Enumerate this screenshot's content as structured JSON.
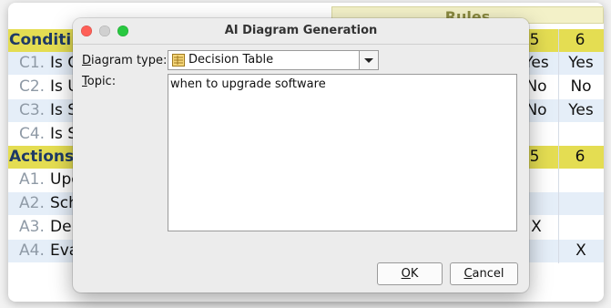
{
  "background_table": {
    "rules_header": "Rules",
    "conditions_label": "Conditi",
    "actions_label": "Actions",
    "rule_numbers": [
      "5",
      "6"
    ],
    "conditions": [
      {
        "id": "C1.",
        "text": "Is C",
        "r5": "Yes",
        "r6": "Yes"
      },
      {
        "id": "C2.",
        "text": "Is U",
        "r5": "No",
        "r6": "No"
      },
      {
        "id": "C3.",
        "text": "Is S",
        "r5": "No",
        "r6": "Yes"
      },
      {
        "id": "C4.",
        "text": "Is S",
        "r5": "",
        "r6": ""
      }
    ],
    "actions": [
      {
        "id": "A1.",
        "text": "Upg",
        "r5": "",
        "r6": ""
      },
      {
        "id": "A2.",
        "text": "Sch",
        "r5": "",
        "r6": ""
      },
      {
        "id": "A3.",
        "text": "Del",
        "r5": "X",
        "r6": ""
      },
      {
        "id": "A4.",
        "text": "Eva",
        "r5": "",
        "r6": "X"
      }
    ]
  },
  "dialog": {
    "title": "AI Diagram Generation",
    "diagram_type_label_pre": "",
    "diagram_type_label_mnemonic": "D",
    "diagram_type_label_post": "iagram type:",
    "diagram_type_value": "Decision Table",
    "topic_label_mnemonic": "T",
    "topic_label_post": "opic:",
    "topic_value": "when to upgrade software",
    "ok_mnemonic": "O",
    "ok_post": "K",
    "cancel_mnemonic": "C",
    "cancel_post": "ancel",
    "close_color": "#fe5f57",
    "minimize_color": "#d0d0d0",
    "zoom_color": "#28c840"
  }
}
